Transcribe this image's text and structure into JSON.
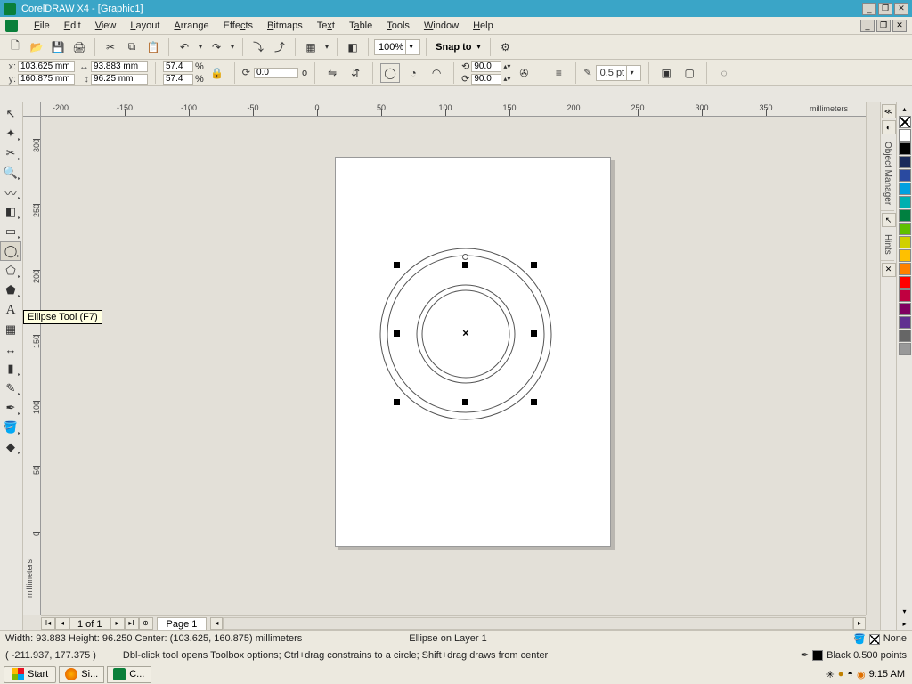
{
  "title": "CorelDRAW X4 - [Graphic1]",
  "menus": [
    "File",
    "Edit",
    "View",
    "Layout",
    "Arrange",
    "Effects",
    "Bitmaps",
    "Text",
    "Table",
    "Tools",
    "Window",
    "Help"
  ],
  "toolbar1": {
    "zoom": "100%",
    "snap_label": "Snap to"
  },
  "prop": {
    "x_label": "x:",
    "y_label": "y:",
    "x": "103.625 mm",
    "y": "160.875 mm",
    "w": "93.883 mm",
    "h": "96.25 mm",
    "scale_x": "57.4",
    "scale_y": "57.4",
    "pct": "%",
    "angle": "0.0",
    "rot_x": "90.0",
    "rot_y": "90.0",
    "deg": "o",
    "outline_label": "0.5 pt"
  },
  "tooltip": "Ellipse Tool (F7)",
  "ruler_unit": "millimeters",
  "page_nav": {
    "count": "1 of 1",
    "tab": "Page 1"
  },
  "right_tabs": [
    "Object Manager",
    "Hints"
  ],
  "palette_colors": [
    "#ffffff",
    "#000000",
    "#1a2a5a",
    "#2a4aa0",
    "#00a0e0",
    "#00b0b0",
    "#008040",
    "#60c000",
    "#d0d000",
    "#ffc000",
    "#ff8000",
    "#ff0000",
    "#c00040",
    "#800060",
    "#603090",
    "#666666",
    "#999999"
  ],
  "status1": {
    "left": "Width: 93.883 Height: 96.250 Center: (103.625, 160.875)  millimeters",
    "mid": "Ellipse on Layer 1",
    "fill_label": "None"
  },
  "status2": {
    "coord": "( -211.937, 177.375 )",
    "tip": "Dbl-click tool opens Toolbox options; Ctrl+drag constrains to a circle; Shift+drag draws from center",
    "outline_label": "Black  0.500 points"
  },
  "taskbar": {
    "start": "Start",
    "tasks": [
      "Si...",
      "C..."
    ],
    "clock": "9:15 AM"
  }
}
